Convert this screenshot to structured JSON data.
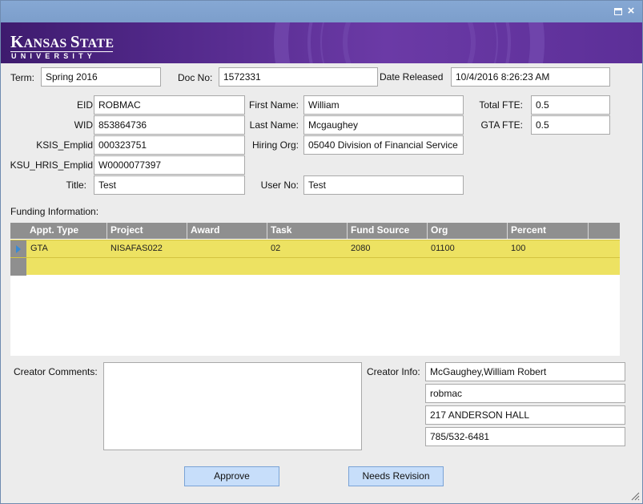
{
  "banner": {
    "logo_prefix_k": "K",
    "logo_rest_1": "ANSAS ",
    "logo_prefix_s": "S",
    "logo_rest_2": "TATE",
    "logo_sub": "UNIVERSITY"
  },
  "window_controls": {
    "maximize_icon": "maximize-icon",
    "close_icon": "close-icon"
  },
  "header": {
    "term_label": "Term:",
    "term_value": "Spring 2016",
    "docno_label": "Doc No:",
    "docno_value": "1572331",
    "released_label": "Date Released",
    "released_value": "10/4/2016 8:26:23 AM"
  },
  "person": {
    "eid_label": "EID",
    "eid_value": "ROBMAC",
    "wid_label": "WID",
    "wid_value": "853864736",
    "ksis_label": "KSIS_Emplid",
    "ksis_value": "000323751",
    "hris_label": "KSU_HRIS_Emplid",
    "hris_value": "W0000077397",
    "title_label": "Title:",
    "title_value": "Test",
    "first_label": "First Name:",
    "first_value": "William",
    "last_label": "Last Name:",
    "last_value": "Mcgaughey",
    "org_label": "Hiring Org:",
    "org_value": "05040 Division of Financial Service",
    "userno_label": "User No:",
    "userno_value": "Test",
    "fte_label": "Total FTE:",
    "fte_value": "0.5",
    "gtafte_label": "GTA FTE:",
    "gtafte_value": "0.5"
  },
  "funding": {
    "label": "Funding Information:",
    "columns": [
      "Appt. Type",
      "Project",
      "Award",
      "Task",
      "Fund Source",
      "Org",
      "Percent"
    ],
    "rows": [
      [
        "GTA",
        "NISAFAS022",
        "",
        "02",
        "2080",
        "01100",
        "100"
      ]
    ]
  },
  "creator": {
    "comments_label": "Creator Comments:",
    "comments_value": "",
    "info_label": "Creator Info:",
    "info": [
      "McGaughey,William Robert",
      "robmac",
      "217 ANDERSON HALL",
      "785/532-6481"
    ]
  },
  "actions": {
    "approve": "Approve",
    "revision": "Needs Revision"
  },
  "colors": {
    "accent": "#512889",
    "row_highlight": "#ede262",
    "button": "#c7defa"
  }
}
